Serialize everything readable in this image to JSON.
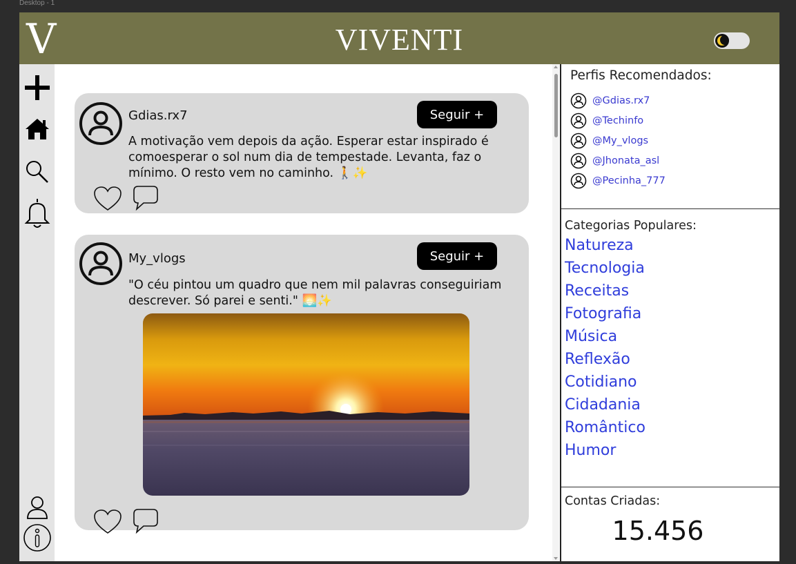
{
  "canvas": {
    "label": "Desktop - 1"
  },
  "header": {
    "logo": "V",
    "brand": "VIVENTI",
    "theme_toggle": "dark-mode-toggle"
  },
  "sidebar": {
    "top_icons": [
      "plus-icon",
      "home-icon",
      "search-icon",
      "bell-icon"
    ],
    "bottom_icons": [
      "user-icon",
      "info-icon"
    ]
  },
  "posts": [
    {
      "username": "Gdias.rx7",
      "follow_label": "Seguir +",
      "text": "A motivação vem depois da ação. Esperar estar inspirado é\n comoesperar o sol num dia de tempestade. Levanta, faz o\nmínimo. O resto vem no caminho. 🚶✨"
    },
    {
      "username": "My_vlogs",
      "follow_label": "Seguir +",
      "text": "\"O céu pintou um quadro que nem mil palavras conseguiriam\ndescrever. Só parei e senti.\" 🌅✨",
      "has_image": true
    }
  ],
  "right": {
    "recommended_title": "Perfis Recomendados:",
    "profiles": [
      "@Gdias.rx7",
      "@Techinfo",
      "@My_vlogs",
      "@Jhonata_asl",
      "@Pecinha_777"
    ],
    "categories_title": "Categorias Populares:",
    "categories": [
      "Natureza",
      "Tecnologia",
      "Receitas",
      "Fotografia",
      "Música",
      "Reflexão",
      "Cotidiano",
      "Cidadania",
      "Romântico",
      "Humor"
    ],
    "accounts_title": "Contas Criadas:",
    "accounts_count": "15.456"
  },
  "colors": {
    "header": "#737349",
    "sidebar": "#e4e4e4",
    "card": "#d9d9d9",
    "link": "#2f3ddb",
    "follow_button": "#000000"
  }
}
